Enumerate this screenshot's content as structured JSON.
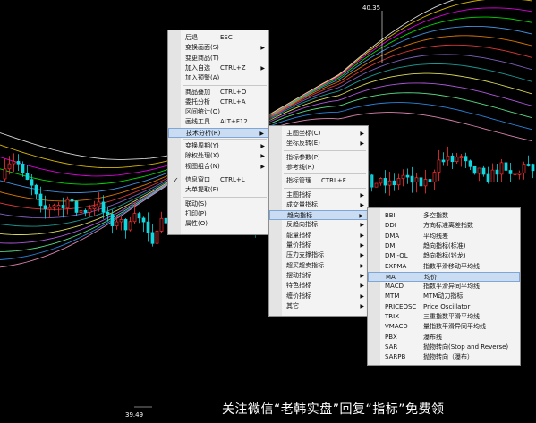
{
  "price_marks": {
    "high": "40.35",
    "low": "39.49"
  },
  "context_menu": {
    "items": [
      {
        "label": "后退",
        "shortcut": "ESC",
        "arrow": false,
        "checked": false,
        "sep_after": false
      },
      {
        "label": "变换画面(S)",
        "shortcut": "",
        "arrow": true,
        "checked": false,
        "sep_after": false
      },
      {
        "label": "变更商品(T)",
        "shortcut": "",
        "arrow": false,
        "checked": false,
        "sep_after": false
      },
      {
        "label": "加入自选",
        "shortcut": "CTRL+Z",
        "arrow": true,
        "checked": false,
        "sep_after": false
      },
      {
        "label": "加入预警(A)",
        "shortcut": "",
        "arrow": false,
        "checked": false,
        "sep_after": true
      },
      {
        "label": "商品叠加",
        "shortcut": "CTRL+O",
        "arrow": false,
        "checked": false,
        "sep_after": false
      },
      {
        "label": "委托分析",
        "shortcut": "CTRL+A",
        "arrow": false,
        "checked": false,
        "sep_after": false
      },
      {
        "label": "区间统计(Q)",
        "shortcut": "",
        "arrow": false,
        "checked": false,
        "sep_after": false
      },
      {
        "label": "画线工具",
        "shortcut": "ALT+F12",
        "arrow": false,
        "checked": false,
        "sep_after": false
      },
      {
        "label": "技术分析(R)",
        "shortcut": "",
        "arrow": true,
        "checked": false,
        "sep_after": true,
        "highlighted": true
      },
      {
        "label": "变换周期(Y)",
        "shortcut": "",
        "arrow": true,
        "checked": false,
        "sep_after": false
      },
      {
        "label": "除权处理(X)",
        "shortcut": "",
        "arrow": true,
        "checked": false,
        "sep_after": false
      },
      {
        "label": "视图组合(N)",
        "shortcut": "",
        "arrow": true,
        "checked": false,
        "sep_after": true
      },
      {
        "label": "信息窗口",
        "shortcut": "CTRL+L",
        "arrow": false,
        "checked": true,
        "sep_after": false
      },
      {
        "label": "大单提取(F)",
        "shortcut": "",
        "arrow": false,
        "checked": false,
        "sep_after": true
      },
      {
        "label": "联动(S)",
        "shortcut": "",
        "arrow": false,
        "checked": false,
        "sep_after": false
      },
      {
        "label": "打印(P)",
        "shortcut": "",
        "arrow": false,
        "checked": false,
        "sep_after": false
      },
      {
        "label": "属性(O)",
        "shortcut": "",
        "arrow": false,
        "checked": false,
        "sep_after": false
      }
    ]
  },
  "tech_menu": {
    "items": [
      {
        "label": "主图坐标(C)",
        "shortcut": "",
        "arrow": true,
        "sep_after": false
      },
      {
        "label": "坐标反转(E)",
        "shortcut": "",
        "arrow": true,
        "sep_after": true
      },
      {
        "label": "指标参数(P)",
        "shortcut": "",
        "arrow": false,
        "sep_after": false
      },
      {
        "label": "参考线(R)",
        "shortcut": "",
        "arrow": false,
        "sep_after": true
      },
      {
        "label": "指标管理",
        "shortcut": "CTRL+F",
        "arrow": false,
        "sep_after": true
      },
      {
        "label": "主图指标",
        "shortcut": "",
        "arrow": true,
        "sep_after": false
      },
      {
        "label": "成交量指标",
        "shortcut": "",
        "arrow": true,
        "sep_after": false
      },
      {
        "label": "趋向指标",
        "shortcut": "",
        "arrow": true,
        "sep_after": false,
        "highlighted": true
      },
      {
        "label": "反趋向指标",
        "shortcut": "",
        "arrow": true,
        "sep_after": false
      },
      {
        "label": "能量指标",
        "shortcut": "",
        "arrow": true,
        "sep_after": false
      },
      {
        "label": "量价指标",
        "shortcut": "",
        "arrow": true,
        "sep_after": false
      },
      {
        "label": "压力支撑指标",
        "shortcut": "",
        "arrow": true,
        "sep_after": false
      },
      {
        "label": "超买超卖指标",
        "shortcut": "",
        "arrow": true,
        "sep_after": false
      },
      {
        "label": "摆动指标",
        "shortcut": "",
        "arrow": true,
        "sep_after": false
      },
      {
        "label": "特色指标",
        "shortcut": "",
        "arrow": true,
        "sep_after": false
      },
      {
        "label": "缠价指标",
        "shortcut": "",
        "arrow": true,
        "sep_after": false
      },
      {
        "label": "其它",
        "shortcut": "",
        "arrow": true,
        "sep_after": false
      }
    ]
  },
  "trend_menu": {
    "items": [
      {
        "code": "BBI",
        "desc": "多空指数"
      },
      {
        "code": "DDI",
        "desc": "方向标准离差指数"
      },
      {
        "code": "DMA",
        "desc": "平均线差"
      },
      {
        "code": "DMI",
        "desc": "趋向指标(标准)"
      },
      {
        "code": "DMI-QL",
        "desc": "趋向指标(钱龙)"
      },
      {
        "code": "EXPMA",
        "desc": "指数平滑移动平均线"
      },
      {
        "code": "MA",
        "desc": "均价",
        "highlighted": true
      },
      {
        "code": "MACD",
        "desc": "指数平滑异同平均线"
      },
      {
        "code": "MTM",
        "desc": "MTM动力指标"
      },
      {
        "code": "PRICEOSC",
        "desc": "Price Oscillator"
      },
      {
        "code": "TRIX",
        "desc": "三重指数平滑平均线"
      },
      {
        "code": "VMACD",
        "desc": "量指数平滑异同平均线"
      },
      {
        "code": "PBX",
        "desc": "瀑布线"
      },
      {
        "code": "SAR",
        "desc": "抛物转向(Stop and Reverse)"
      },
      {
        "code": "SARPB",
        "desc": "抛物转向（瀑布）"
      }
    ]
  },
  "watermark": {
    "text": "关注微信“老韩实盘”回复“指标”免费领"
  },
  "colors": {
    "up": "#ff3030",
    "down": "#10d8e0",
    "menu_bg": "#f3f3f3",
    "highlight": "#c9dcf2"
  }
}
